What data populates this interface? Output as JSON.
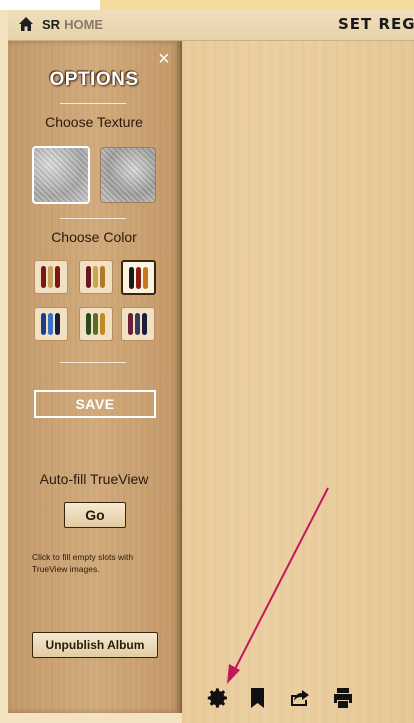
{
  "header": {
    "brand_bold": "SR",
    "brand_muted": "HOME",
    "page_title": "SET REGI"
  },
  "sidebar": {
    "title": "OPTIONS",
    "close": "×",
    "choose_texture": "Choose Texture",
    "choose_color": "Choose Color",
    "textures": [
      {
        "name": "texture-option-1",
        "selected": true
      },
      {
        "name": "texture-option-2",
        "selected": false
      }
    ],
    "color_options": [
      {
        "colors": [
          "#7a1a14",
          "#c8a060",
          "#7a1a14"
        ],
        "selected": false
      },
      {
        "colors": [
          "#6b1620",
          "#c9a84a",
          "#b07a2a"
        ],
        "selected": false
      },
      {
        "colors": [
          "#1a1a1a",
          "#8a1e14",
          "#c9781e"
        ],
        "selected": true
      },
      {
        "colors": [
          "#1d3e8c",
          "#3a6fc4",
          "#141d3a"
        ],
        "selected": false
      },
      {
        "colors": [
          "#2c4a1e",
          "#5a6d22",
          "#c08a28"
        ],
        "selected": false
      },
      {
        "colors": [
          "#6a2034",
          "#3a3a5a",
          "#1a1e3a"
        ],
        "selected": false
      }
    ],
    "save_label": "SAVE",
    "autofill_label": "Auto-fill TrueView",
    "go_label": "Go",
    "autofill_note": "Click to fill empty slots with TrueView images.",
    "unpublish_label": "Unpublish Album"
  },
  "toolbar": {
    "icons": [
      "gear-icon",
      "bookmark-icon",
      "share-icon",
      "print-icon"
    ]
  },
  "colors": {
    "annotation_arrow": "#c2185b",
    "sidebar_wood": "#c9a06f",
    "canvas_wood": "#e9cb9b"
  }
}
